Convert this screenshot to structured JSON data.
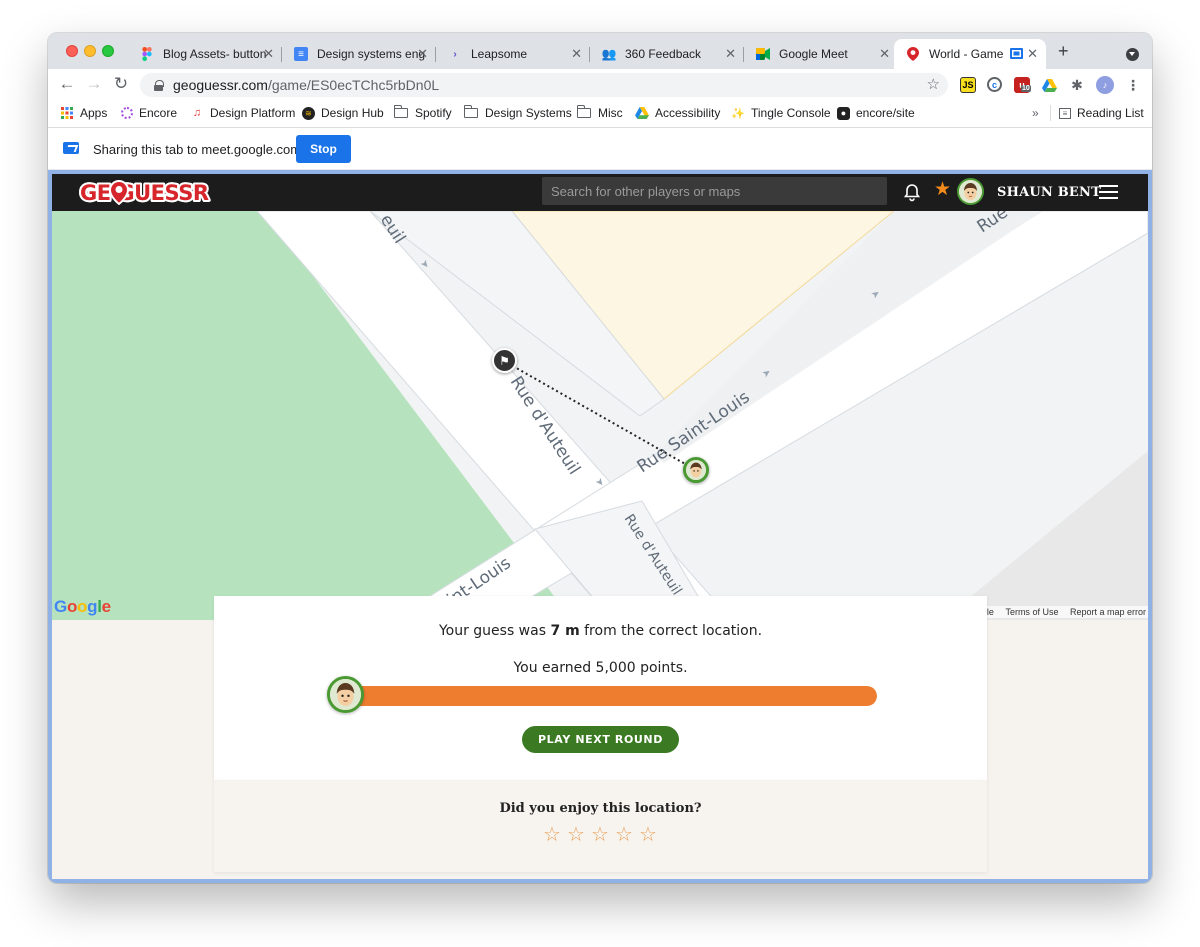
{
  "browser": {
    "tabs": [
      {
        "title": "Blog Assets- button",
        "favicon": "figma-icon",
        "active": false
      },
      {
        "title": "Design systems eng",
        "favicon": "docs-icon",
        "active": false
      },
      {
        "title": "Leapsome",
        "favicon": "leapsome-icon",
        "active": false
      },
      {
        "title": "360 Feedback",
        "favicon": "people-icon",
        "active": false
      },
      {
        "title": "Google Meet",
        "favicon": "meet-icon",
        "active": false
      },
      {
        "title": "World - Game -",
        "favicon": "geoguessr-pin-icon",
        "active": true
      }
    ],
    "url_host": "geoguessr.com",
    "url_path": "/game/ES0ecTChc5rbDn0L",
    "extension_badge": "10",
    "bookmarks": [
      {
        "label": "Apps",
        "icon": "apps-grid-icon"
      },
      {
        "label": "Encore",
        "icon": "encore-icon"
      },
      {
        "label": "Design Platform",
        "icon": "music-note-icon"
      },
      {
        "label": "Design Hub",
        "icon": "spotify-icon"
      },
      {
        "label": "Spotify",
        "icon": "folder-icon"
      },
      {
        "label": "Design Systems",
        "icon": "folder-icon"
      },
      {
        "label": "Misc",
        "icon": "folder-icon"
      },
      {
        "label": "Accessibility",
        "icon": "drive-icon"
      },
      {
        "label": "Tingle Console",
        "icon": "sparkle-icon"
      },
      {
        "label": "encore/site",
        "icon": "github-icon"
      }
    ],
    "bookmarks_overflow": "»",
    "reading_list": "Reading List",
    "sharing": {
      "text": "Sharing this tab to meet.google.com",
      "stop_label": "Stop"
    }
  },
  "geoguessr": {
    "logo_text": "GEOGUESSR",
    "search_placeholder": "Search for other players or maps",
    "username": "SHAUN BENT",
    "map": {
      "streets": [
        "Rue Saint-Louis",
        "Rue d'Auteuil",
        "Rue d'Auteuil",
        "int-Louis",
        "euil",
        "Rue"
      ],
      "google_logo": "Google",
      "footer": [
        "ogle",
        "Terms of Use",
        "Report a map error"
      ]
    },
    "result": {
      "guess_prefix": "Your guess was ",
      "distance": "7 m",
      "guess_suffix": " from the correct location.",
      "points_text": "You earned 5,000 points.",
      "progress_fraction": 1.0,
      "next_button": "PLAY NEXT ROUND"
    },
    "rating": {
      "question": "Did you enjoy this location?",
      "stars_total": 5,
      "stars_selected": 0
    }
  },
  "colors": {
    "accent_orange": "#ef7d2f",
    "button_green": "#3b7a23",
    "logo_red": "#e2232e",
    "chrome_blue": "#1a73e8"
  }
}
